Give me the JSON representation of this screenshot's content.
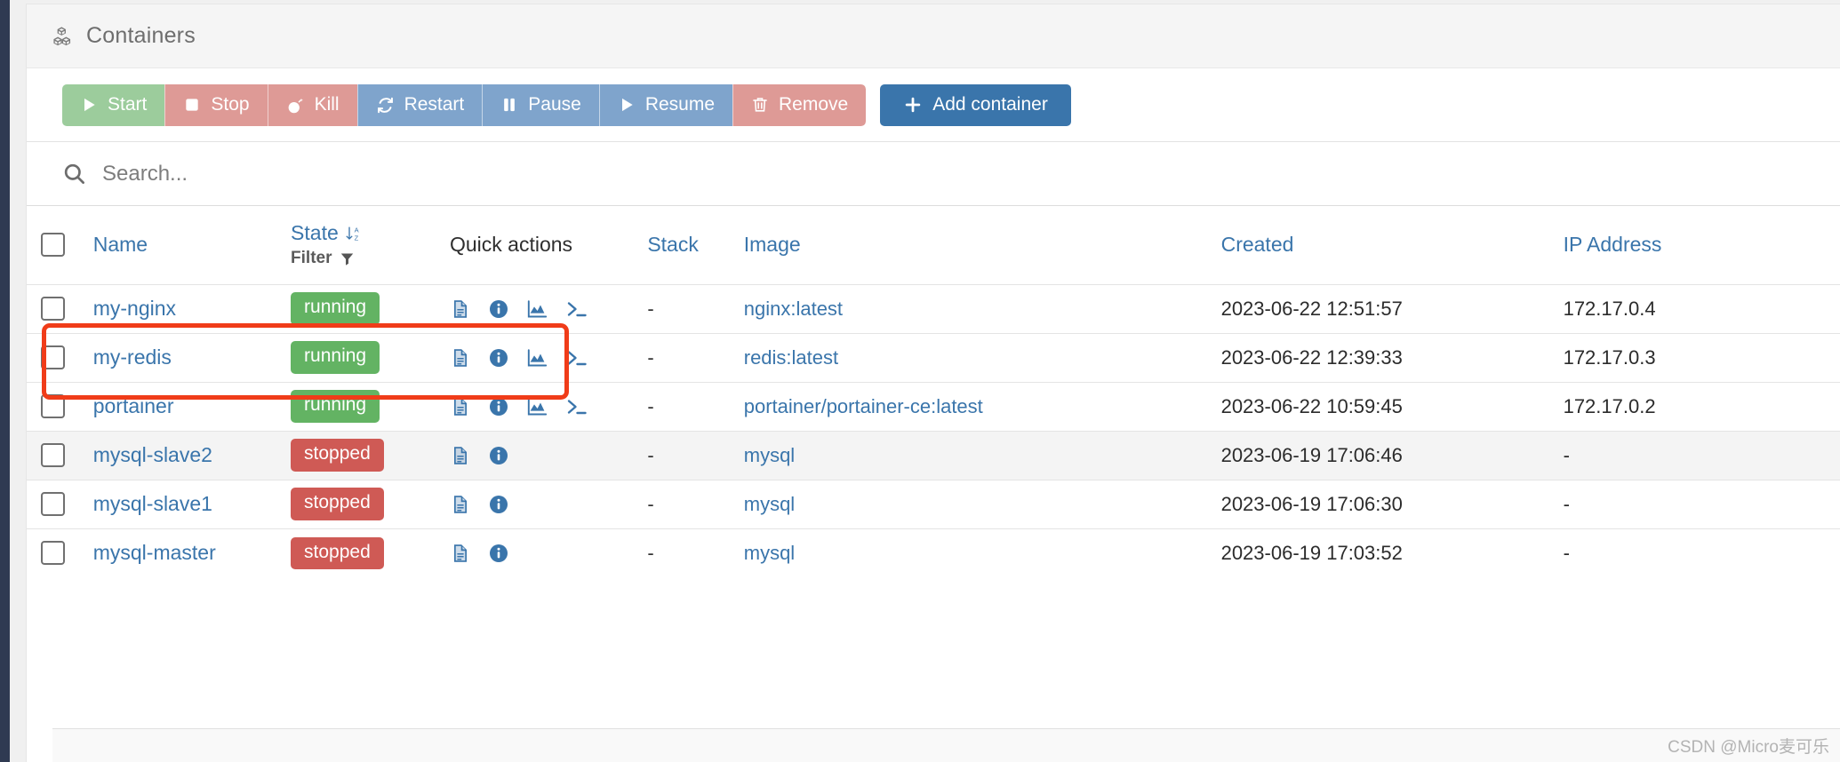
{
  "card": {
    "title": "Containers",
    "title_icon": "containers-icon"
  },
  "toolbar": {
    "buttons": [
      {
        "label": "Start",
        "icon": "play-icon",
        "color": "#9ccc9c"
      },
      {
        "label": "Stop",
        "icon": "square-icon",
        "color": "#de9a96"
      },
      {
        "label": "Kill",
        "icon": "bomb-icon",
        "color": "#de9a96"
      },
      {
        "label": "Restart",
        "icon": "refresh-icon",
        "color": "#7fa4cc"
      },
      {
        "label": "Pause",
        "icon": "pause-icon",
        "color": "#7fa4cc"
      },
      {
        "label": "Resume",
        "icon": "play-icon",
        "color": "#7fa4cc"
      },
      {
        "label": "Remove",
        "icon": "trash-icon",
        "color": "#de9a96"
      }
    ],
    "add_container": {
      "label": "Add container",
      "icon": "plus-icon",
      "color": "#3a75ab"
    }
  },
  "search": {
    "icon": "search-icon",
    "placeholder": "Search...",
    "value": ""
  },
  "table": {
    "headers": {
      "select_all": "",
      "name": "Name",
      "state": "State",
      "state_sort_icon": "sort-az-descending-icon",
      "filter_label": "Filter",
      "filter_icon": "funnel-icon",
      "quick_actions": "Quick actions",
      "stack": "Stack",
      "image": "Image",
      "created": "Created",
      "ip_address": "IP Address"
    },
    "rows": [
      {
        "name": "my-nginx",
        "state": "running",
        "quick_actions": [
          "logs-icon",
          "info-icon",
          "stats-icon",
          "console-icon"
        ],
        "stack": "-",
        "image": "nginx:latest",
        "created": "2023-06-22 12:51:57",
        "ip": "172.17.0.4",
        "striped": false
      },
      {
        "name": "my-redis",
        "state": "running",
        "quick_actions": [
          "logs-icon",
          "info-icon",
          "stats-icon",
          "console-icon"
        ],
        "stack": "-",
        "image": "redis:latest",
        "created": "2023-06-22 12:39:33",
        "ip": "172.17.0.3",
        "striped": false
      },
      {
        "name": "portainer",
        "state": "running",
        "quick_actions": [
          "logs-icon",
          "info-icon",
          "stats-icon",
          "console-icon"
        ],
        "stack": "-",
        "image": "portainer/portainer-ce:latest",
        "created": "2023-06-22 10:59:45",
        "ip": "172.17.0.2",
        "striped": false
      },
      {
        "name": "mysql-slave2",
        "state": "stopped",
        "quick_actions": [
          "logs-icon",
          "info-icon"
        ],
        "stack": "-",
        "image": "mysql",
        "created": "2023-06-19 17:06:46",
        "ip": "-",
        "striped": true
      },
      {
        "name": "mysql-slave1",
        "state": "stopped",
        "quick_actions": [
          "logs-icon",
          "info-icon"
        ],
        "stack": "-",
        "image": "mysql",
        "created": "2023-06-19 17:06:30",
        "ip": "-",
        "striped": false
      },
      {
        "name": "mysql-master",
        "state": "stopped",
        "quick_actions": [
          "logs-icon",
          "info-icon"
        ],
        "stack": "-",
        "image": "mysql",
        "created": "2023-06-19 17:03:52",
        "ip": "-",
        "striped": false
      }
    ]
  },
  "annotation": {
    "type": "rectangle-highlight",
    "color": "#f03c19"
  },
  "footer": {
    "watermark": "CSDN @Micro麦可乐"
  },
  "colors": {
    "link": "#3a75ab",
    "running_badge": "#63b363",
    "stopped_badge": "#cf5a55",
    "primary_button": "#3a75ab"
  }
}
